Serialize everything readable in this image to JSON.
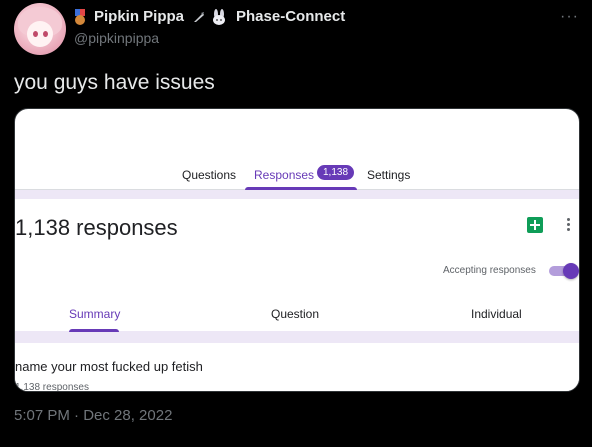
{
  "author": {
    "display_name": "Pipkin Pippa",
    "affiliation": "Phase-Connect",
    "handle": "@pipkinpippa"
  },
  "tweet": {
    "text": "you guys have issues",
    "timestamp": "5:07 PM · Dec 28, 2022"
  },
  "form": {
    "tabs": [
      "Questions",
      "Responses",
      "Settings"
    ],
    "response_badge": "1,138",
    "title": "1,138 responses",
    "accepting_label": "Accepting responses",
    "accepting_on": true,
    "sub_tabs": [
      "Summary",
      "Question",
      "Individual"
    ],
    "question_title": "name your most fucked up fetish",
    "question_count": "1,138 responses"
  },
  "colors": {
    "accent": "#673ab7",
    "sheets": "#0f9d58"
  }
}
